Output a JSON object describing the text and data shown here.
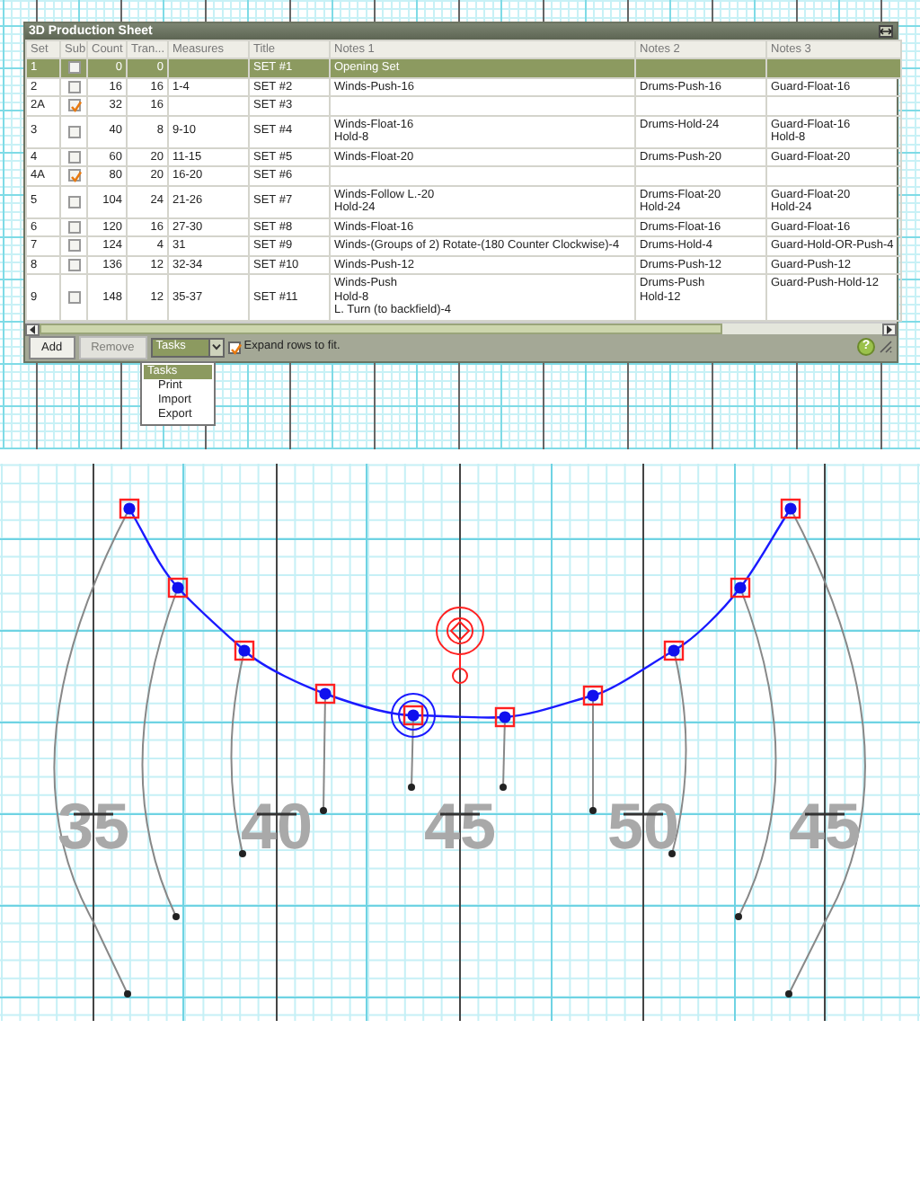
{
  "window": {
    "title": "3D Production Sheet"
  },
  "table": {
    "columns": [
      "Set",
      "Sub",
      "Count",
      "Tran...",
      "Measures",
      "Title",
      "Notes 1",
      "Notes 2",
      "Notes 3"
    ],
    "rows": [
      {
        "set": "1",
        "sub": false,
        "count": "0",
        "transition": "0",
        "title": "SET #1",
        "notes_1": [
          "Opening Set"
        ],
        "selected": true
      },
      {
        "set": "2",
        "sub": false,
        "count": "16",
        "transition": "16",
        "measures": "1-4",
        "title": "SET #2",
        "notes_1": [
          "Winds-Push-16"
        ],
        "notes_2": [
          "Drums-Push-16"
        ],
        "notes_3": [
          "Guard-Float-16"
        ],
        "selected": false
      },
      {
        "set": "2A",
        "sub": true,
        "count": "32",
        "transition": "16",
        "title": "SET #3",
        "selected": false
      },
      {
        "set": "3",
        "sub": false,
        "count": "40",
        "transition": "8",
        "measures": "9-10",
        "title": "SET #4",
        "notes_1": [
          "Winds-Float-16",
          "Hold-8"
        ],
        "notes_2": [
          "Drums-Hold-24"
        ],
        "notes_3": [
          "Guard-Float-16",
          "Hold-8"
        ],
        "selected": false
      },
      {
        "set": "4",
        "sub": false,
        "count": "60",
        "transition": "20",
        "measures": "11-15",
        "title": "SET #5",
        "notes_1": [
          "Winds-Float-20"
        ],
        "notes_2": [
          "Drums-Push-20"
        ],
        "notes_3": [
          "Guard-Float-20"
        ],
        "selected": false
      },
      {
        "set": "4A",
        "sub": true,
        "count": "80",
        "transition": "20",
        "measures": "16-20",
        "title": "SET #6",
        "selected": false
      },
      {
        "set": "5",
        "sub": false,
        "count": "104",
        "transition": "24",
        "measures": "21-26",
        "title": "SET #7",
        "notes_1": [
          "Winds-Follow L.-20",
          "Hold-24"
        ],
        "notes_2": [
          "Drums-Float-20",
          "Hold-24"
        ],
        "notes_3": [
          "Guard-Float-20",
          "Hold-24"
        ],
        "selected": false
      },
      {
        "set": "6",
        "sub": false,
        "count": "120",
        "transition": "16",
        "measures": "27-30",
        "title": "SET #8",
        "notes_1": [
          "Winds-Float-16"
        ],
        "notes_2": [
          "Drums-Float-16"
        ],
        "notes_3": [
          "Guard-Float-16"
        ],
        "selected": false
      },
      {
        "set": "7",
        "sub": false,
        "count": "124",
        "transition": "4",
        "measures": "31",
        "title": "SET #9",
        "notes_1": [
          "Winds-(Groups of 2) Rotate-(180 Counter Clockwise)-4"
        ],
        "notes_2": [
          "Drums-Hold-4"
        ],
        "notes_3": [
          "Guard-Hold-OR-Push-4"
        ],
        "selected": false
      },
      {
        "set": "8",
        "sub": false,
        "count": "136",
        "transition": "12",
        "measures": "32-34",
        "title": "SET #10",
        "notes_1": [
          "Winds-Push-12"
        ],
        "notes_2": [
          "Drums-Push-12"
        ],
        "notes_3": [
          "Guard-Push-12"
        ],
        "selected": false
      },
      {
        "set": "9",
        "sub": false,
        "count": "148",
        "transition": "12",
        "measures": "35-37",
        "title": "SET #11",
        "notes_1": [
          "Winds-Push",
          "Hold-8",
          "L. Turn (to backfield)-4"
        ],
        "notes_2": [
          "Drums-Push",
          "Hold-12"
        ],
        "notes_3": [
          "Guard-Push-Hold-12"
        ],
        "selected": false
      }
    ]
  },
  "toolbar": {
    "buttons": [
      {
        "label": "Add",
        "disabled": false
      },
      {
        "label": "Remove",
        "disabled": true
      }
    ],
    "tasks_dropdown": {
      "value": "Tasks",
      "expanded": true,
      "options": [
        {
          "label": "Tasks",
          "selected": true
        },
        {
          "label": "Print",
          "selected": false
        },
        {
          "label": "Import",
          "selected": false
        },
        {
          "label": "Export",
          "selected": false
        }
      ]
    },
    "expand_rows": {
      "label": "Expand rows to fit.",
      "checked": true
    },
    "help_button": {
      "label": "?"
    }
  },
  "field": {
    "yard_numbers": [
      "35",
      "40",
      "45",
      "50",
      "45"
    ]
  }
}
